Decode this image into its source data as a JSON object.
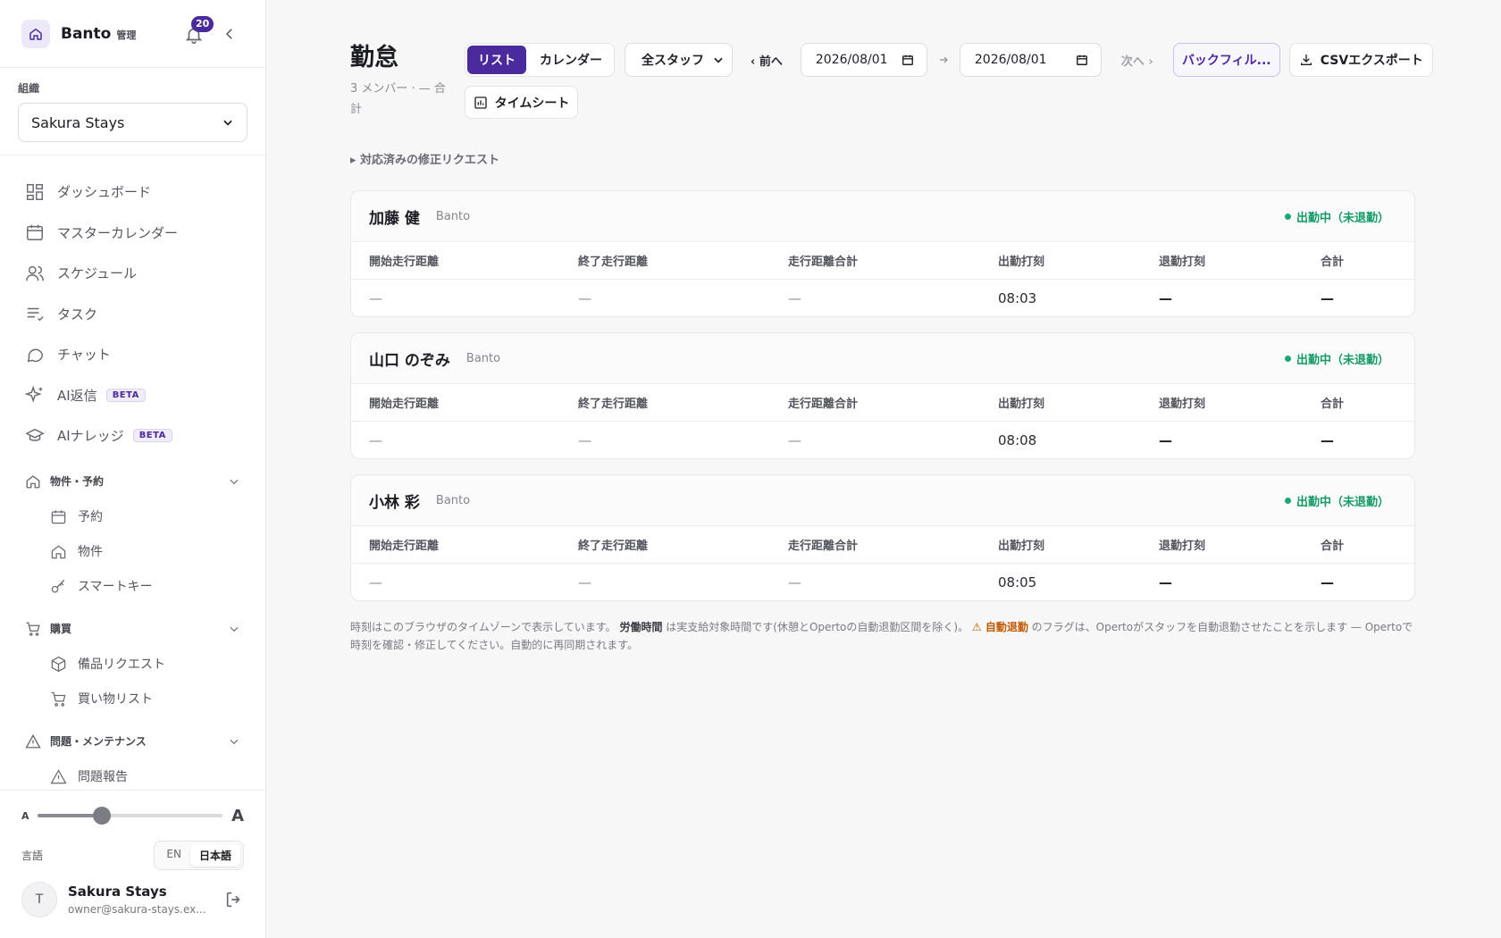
{
  "brand": {
    "name": "Banto",
    "sub": "管理",
    "notifications": "20"
  },
  "org": {
    "label": "組織",
    "value": "Sakura Stays"
  },
  "nav": {
    "items": [
      {
        "label": "ダッシュボード"
      },
      {
        "label": "マスターカレンダー"
      },
      {
        "label": "スケジュール"
      },
      {
        "label": "タスク"
      },
      {
        "label": "チャット"
      },
      {
        "label": "AI返信",
        "badge": "BETA"
      },
      {
        "label": "AIナレッジ",
        "badge": "BETA"
      }
    ],
    "groups": [
      {
        "label": "物件・予約",
        "items": [
          "予約",
          "物件",
          "スマートキー"
        ]
      },
      {
        "label": "購買",
        "items": [
          "備品リクエスト",
          "買い物リスト"
        ]
      },
      {
        "label": "問題・メンテナンス",
        "items": [
          "問題報告"
        ]
      }
    ]
  },
  "bottom": {
    "font_small": "A",
    "font_big": "A",
    "font_level": 0.35,
    "lang_label": "言語",
    "lang_en": "EN",
    "lang_ja": "日本語",
    "avatar": "T",
    "user_name": "Sakura Stays",
    "user_email": "owner@sakura-stays.ex..."
  },
  "page": {
    "title": "勤怠",
    "subtitle": "3 メンバー · — 合計",
    "view_list": "リスト",
    "view_calendar": "カレンダー",
    "staff_select": "全スタッフ",
    "prev": "‹ 前へ",
    "date_from": "2026/08/01",
    "date_to": "2026/08/01",
    "next": "次へ ›",
    "backfill": "バックフィル...",
    "csv": "CSVエクスポート",
    "timesheet": "タイムシート",
    "resolved": "▸ 対応済みの修正リクエスト"
  },
  "columns": [
    "開始走行距離",
    "終了走行距離",
    "走行距離合計",
    "出勤打刻",
    "退勤打刻",
    "合計"
  ],
  "staff": [
    {
      "name": "加藤 健",
      "org": "Banto",
      "status": "出勤中（未退勤）",
      "values": [
        "—",
        "—",
        "—",
        "08:03",
        "—",
        "—"
      ]
    },
    {
      "name": "山口 のぞみ",
      "org": "Banto",
      "status": "出勤中（未退勤）",
      "values": [
        "—",
        "—",
        "—",
        "08:08",
        "—",
        "—"
      ]
    },
    {
      "name": "小林 彩",
      "org": "Banto",
      "status": "出勤中（未退勤）",
      "values": [
        "—",
        "—",
        "—",
        "08:05",
        "—",
        "—"
      ]
    }
  ],
  "footnote": {
    "part1": "時刻はこのブラウザのタイムゾーンで表示しています。",
    "bold1": "労働時間",
    "part2": "は実支給対象時間です(休憩とOpertoの自動退勤区間を除く)。",
    "warn": "⚠ 自動退勤",
    "part3": "のフラグは、Opertoがスタッフを自動退勤させたことを示します — Opertoで時刻を確認・修正してください。自動的に再同期されます。"
  }
}
